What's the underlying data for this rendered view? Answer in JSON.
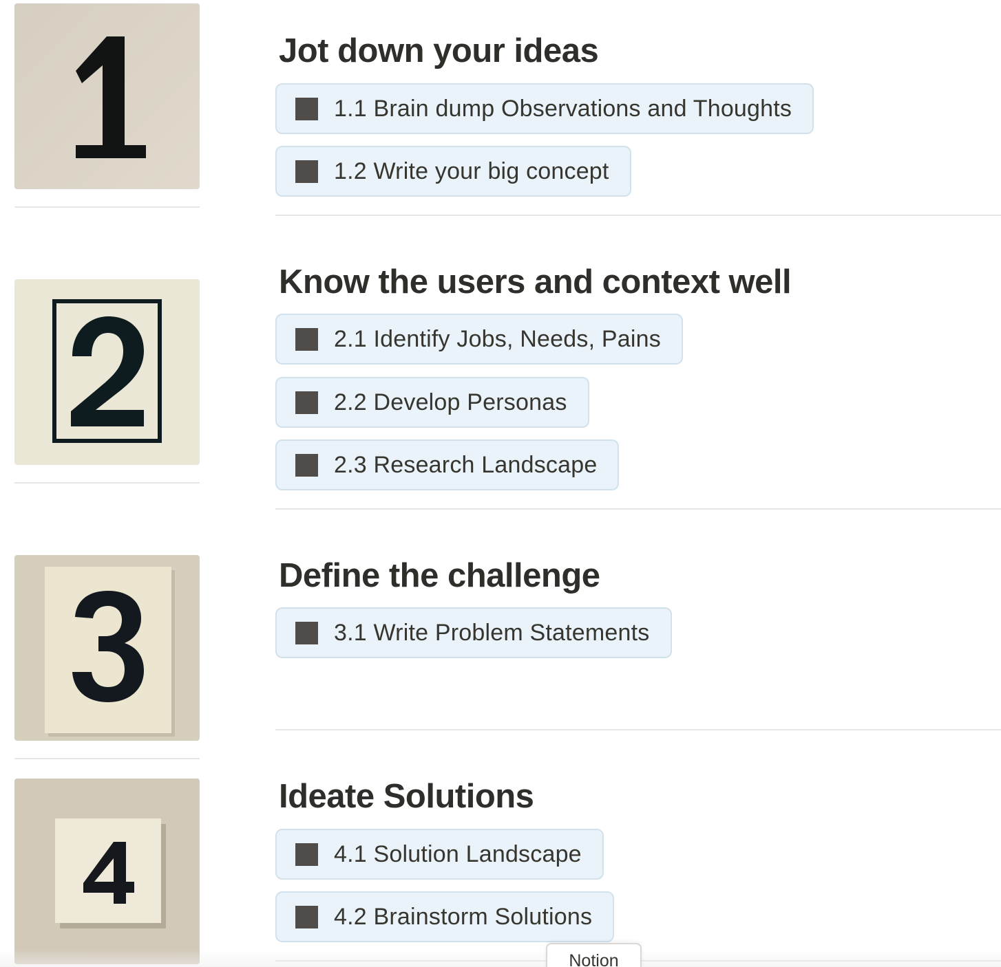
{
  "sections": [
    {
      "thumbnail_number": "1",
      "thumbnail_alt": "number-one-tile",
      "heading": "Jot down your ideas",
      "links": [
        {
          "label": "1.1 Brain dump Observations and Thoughts",
          "icon": "page-square-icon"
        },
        {
          "label": "1.2 Write your big concept",
          "icon": "page-square-icon"
        }
      ]
    },
    {
      "thumbnail_number": "2",
      "thumbnail_alt": "number-two-tile",
      "heading": "Know the users and context well",
      "links": [
        {
          "label": "2.1 Identify Jobs, Needs, Pains",
          "icon": "page-square-icon"
        },
        {
          "label": "2.2 Develop Personas",
          "icon": "page-square-icon"
        },
        {
          "label": "2.3 Research Landscape",
          "icon": "page-square-icon"
        }
      ]
    },
    {
      "thumbnail_number": "3",
      "thumbnail_alt": "number-three-tile",
      "heading": "Define the challenge",
      "links": [
        {
          "label": "3.1 Write Problem Statements",
          "icon": "page-square-icon"
        }
      ]
    },
    {
      "thumbnail_number": "4",
      "thumbnail_alt": "number-four-tile",
      "heading": "Ideate Solutions",
      "links": [
        {
          "label": "4.1 Solution Landscape",
          "icon": "page-square-icon"
        },
        {
          "label": "4.2 Brainstorm Solutions",
          "icon": "page-square-icon"
        }
      ]
    }
  ],
  "footer": {
    "tab_label": "Notion"
  },
  "colors": {
    "chip_background": "#e9f3f9",
    "chip_border": "#d2e2ec",
    "chip_icon": "#4f4c49",
    "heading_text": "#2f2e2b",
    "divider": "#e6e5e3"
  }
}
